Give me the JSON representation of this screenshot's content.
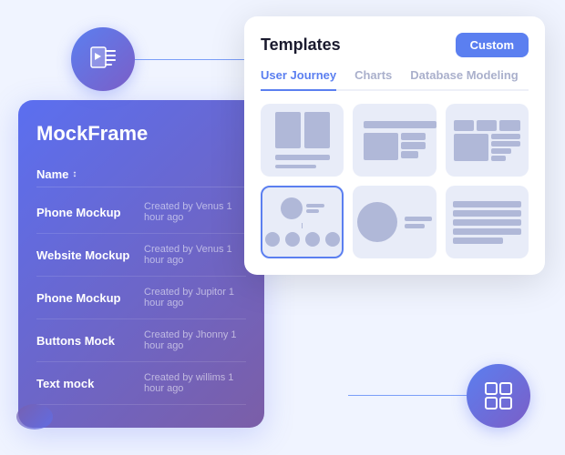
{
  "app": {
    "title": "MockFrame"
  },
  "icons": {
    "top_icon": "▶≡",
    "bottom_icon": "⊞"
  },
  "panel": {
    "title": "MockFrame",
    "list_header": "Name",
    "sort_indicator": "↕",
    "items": [
      {
        "name": "Phone Mockup",
        "meta": "Created by Venus 1 hour ago"
      },
      {
        "name": "Website Mockup",
        "meta": "Created by Venus 1 hour ago"
      },
      {
        "name": "Phone Mockup",
        "meta": "Created by Jupitor 1 hour ago"
      },
      {
        "name": "Buttons Mock",
        "meta": "Created by Jhonny 1 hour ago"
      },
      {
        "name": "Text mock",
        "meta": "Created by willims 1 hour ago"
      }
    ]
  },
  "templates_popup": {
    "title": "Templates",
    "custom_button_label": "Custom",
    "tabs": [
      {
        "label": "User Journey",
        "active": true
      },
      {
        "label": "Charts",
        "active": false
      },
      {
        "label": "Database Modeling",
        "active": false
      }
    ],
    "cards": [
      {
        "id": "card1",
        "type": "mobile-wireframe",
        "selected": false
      },
      {
        "id": "card2",
        "type": "desktop-wireframe",
        "selected": false
      },
      {
        "id": "card3",
        "type": "dashboard-wireframe",
        "selected": false
      },
      {
        "id": "card4",
        "type": "org-chart",
        "selected": true
      },
      {
        "id": "card5",
        "type": "circle-mockup",
        "selected": false
      },
      {
        "id": "card6",
        "type": "lines-wireframe",
        "selected": false
      }
    ]
  },
  "colors": {
    "accent": "#5b7ff0",
    "panel_gradient_start": "#5b6ff0",
    "panel_gradient_end": "#7b5ea7"
  }
}
